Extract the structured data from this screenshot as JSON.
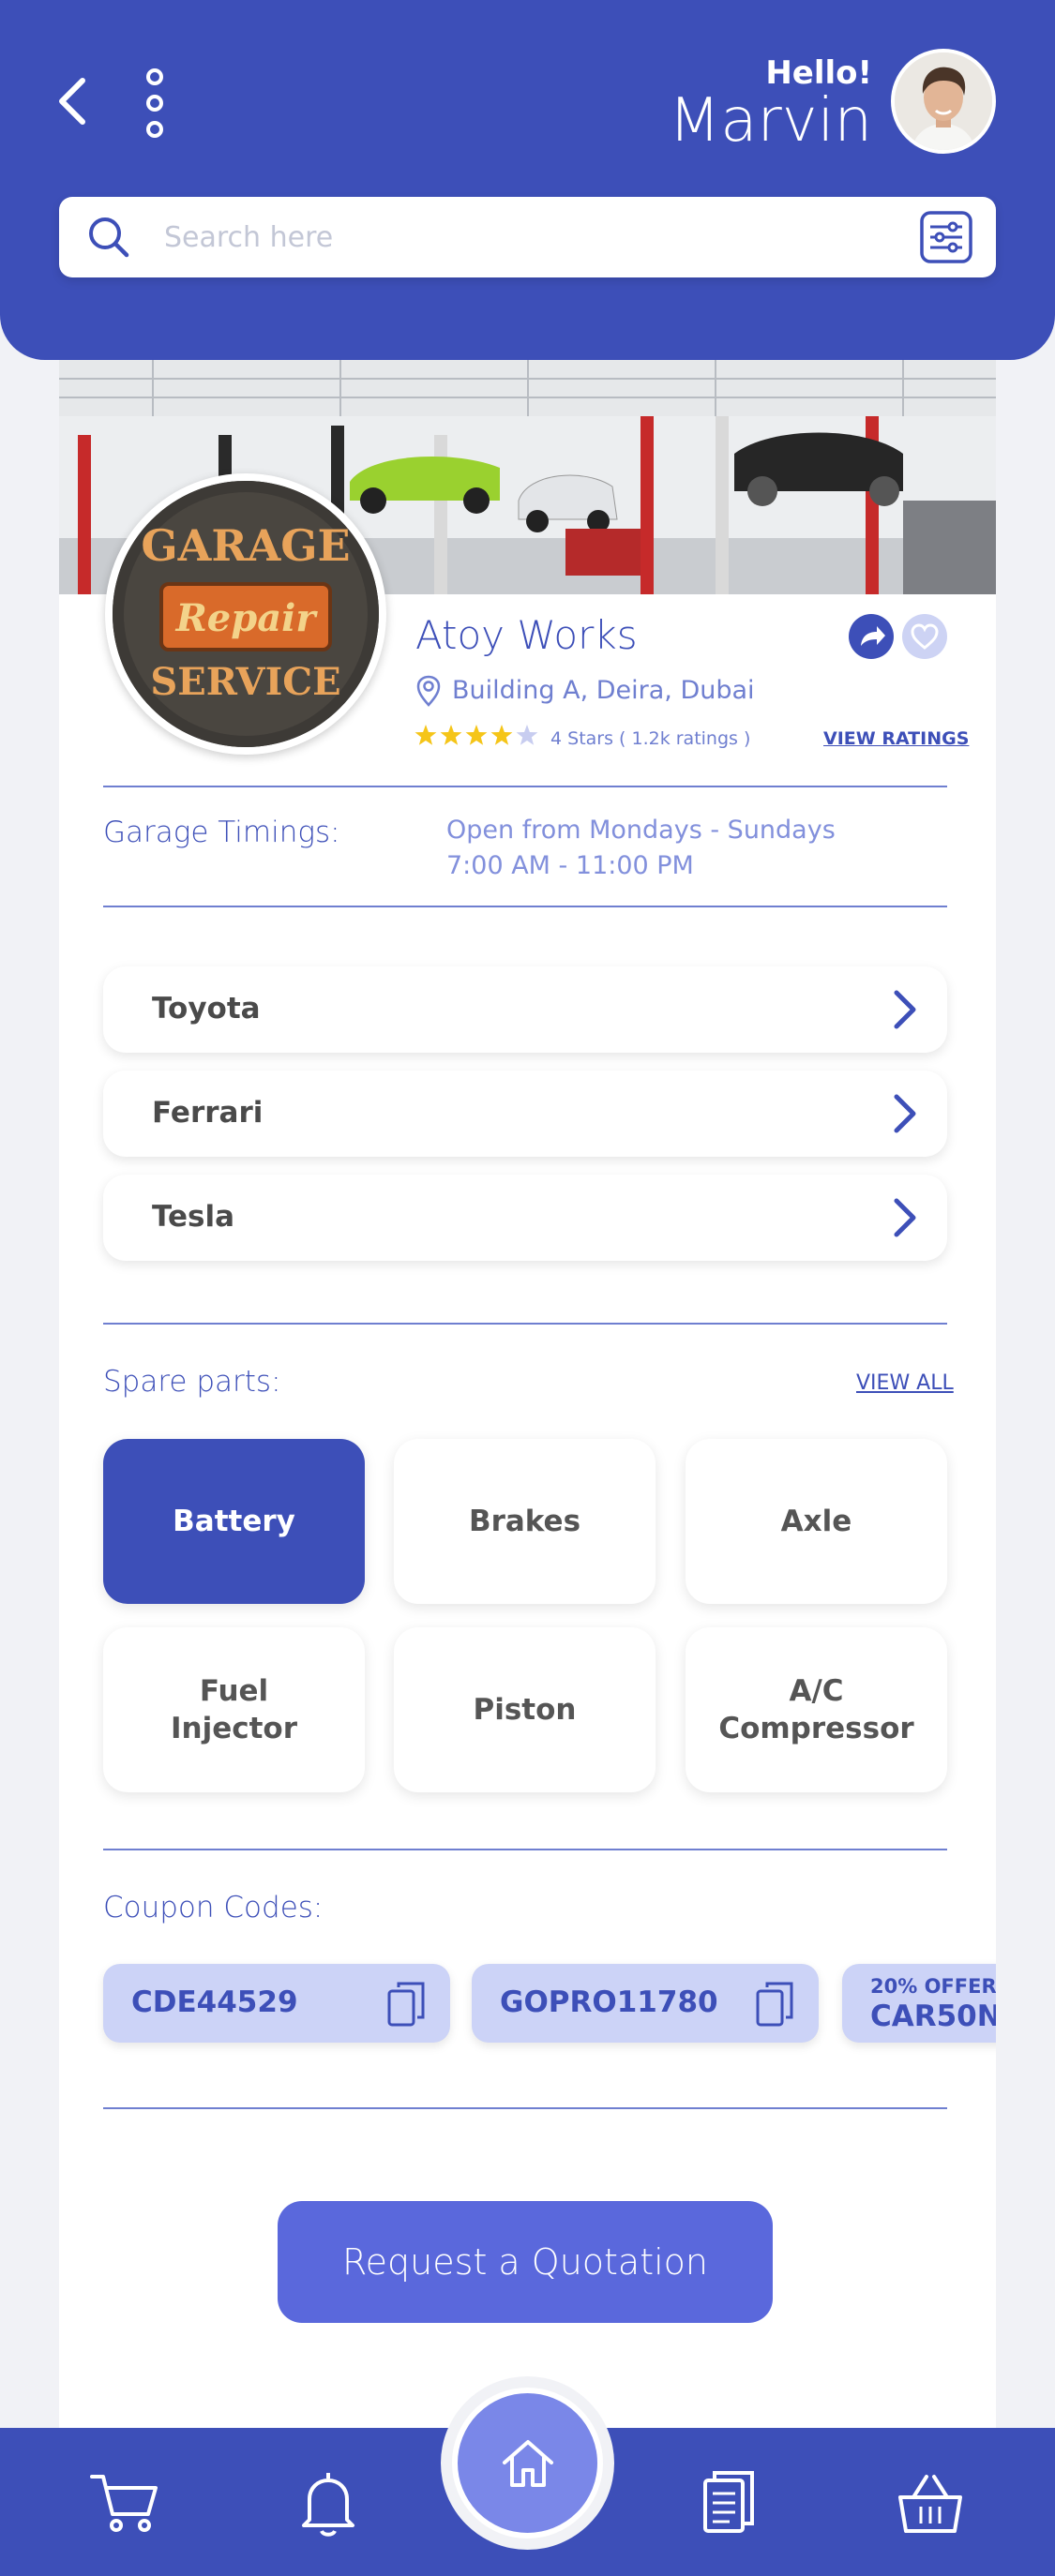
{
  "header": {
    "greeting": "Hello!",
    "user_name": "Marvin"
  },
  "search": {
    "placeholder": "Search here",
    "value": ""
  },
  "garage": {
    "name": "Atoy Works",
    "logo_text_top": "GARAGE",
    "logo_text_middle": "Repair",
    "logo_text_bottom": "SERVICE",
    "location": "Building A, Deira, Dubai",
    "rating_stars": 4,
    "rating_max": 5,
    "rating_text": "4 Stars ( 1.2k ratings )",
    "view_ratings_label": "VIEW RATINGS"
  },
  "timings": {
    "label": "Garage Timings:",
    "days": "Open from Mondays - Sundays",
    "hours": "7:00 AM - 11:00 PM"
  },
  "brands": [
    {
      "label": "Toyota"
    },
    {
      "label": "Ferrari"
    },
    {
      "label": "Tesla"
    }
  ],
  "spare_parts": {
    "title": "Spare parts:",
    "view_all_label": "VIEW ALL",
    "items": [
      {
        "label": "Battery",
        "active": true
      },
      {
        "label": "Brakes",
        "active": false
      },
      {
        "label": "Axle",
        "active": false
      },
      {
        "label": "Fuel\nInjector",
        "active": false
      },
      {
        "label": "Piston",
        "active": false
      },
      {
        "label": "A/C\nCompressor",
        "active": false
      }
    ]
  },
  "coupons": {
    "title": "Coupon Codes:",
    "items": [
      {
        "code": "CDE44529"
      },
      {
        "code": "GOPRO11780"
      },
      {
        "offer": "20% OFFER",
        "code": "CAR50N"
      }
    ]
  },
  "quote_button_label": "Request a Quotation",
  "colors": {
    "primary": "#3d4fb8",
    "accent": "#5a68dc",
    "coupon_bg": "#ccd3f7",
    "star": "#f5c518"
  },
  "nav": {
    "items": [
      "cart-icon",
      "bell-icon",
      "home-icon",
      "documents-icon",
      "basket-icon"
    ]
  }
}
